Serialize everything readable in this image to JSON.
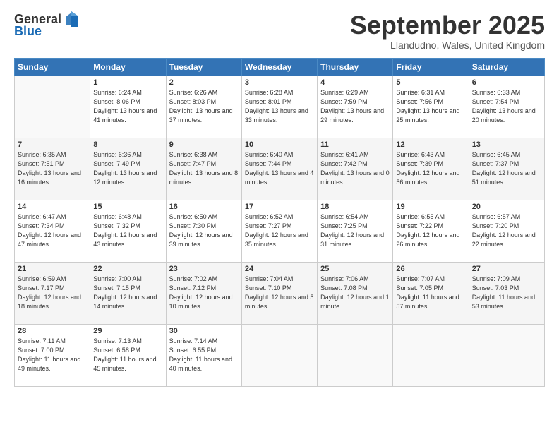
{
  "logo": {
    "general": "General",
    "blue": "Blue"
  },
  "header": {
    "month": "September 2025",
    "location": "Llandudno, Wales, United Kingdom"
  },
  "days_of_week": [
    "Sunday",
    "Monday",
    "Tuesday",
    "Wednesday",
    "Thursday",
    "Friday",
    "Saturday"
  ],
  "weeks": [
    [
      {
        "num": "",
        "sunrise": "",
        "sunset": "",
        "daylight": ""
      },
      {
        "num": "1",
        "sunrise": "Sunrise: 6:24 AM",
        "sunset": "Sunset: 8:06 PM",
        "daylight": "Daylight: 13 hours and 41 minutes."
      },
      {
        "num": "2",
        "sunrise": "Sunrise: 6:26 AM",
        "sunset": "Sunset: 8:03 PM",
        "daylight": "Daylight: 13 hours and 37 minutes."
      },
      {
        "num": "3",
        "sunrise": "Sunrise: 6:28 AM",
        "sunset": "Sunset: 8:01 PM",
        "daylight": "Daylight: 13 hours and 33 minutes."
      },
      {
        "num": "4",
        "sunrise": "Sunrise: 6:29 AM",
        "sunset": "Sunset: 7:59 PM",
        "daylight": "Daylight: 13 hours and 29 minutes."
      },
      {
        "num": "5",
        "sunrise": "Sunrise: 6:31 AM",
        "sunset": "Sunset: 7:56 PM",
        "daylight": "Daylight: 13 hours and 25 minutes."
      },
      {
        "num": "6",
        "sunrise": "Sunrise: 6:33 AM",
        "sunset": "Sunset: 7:54 PM",
        "daylight": "Daylight: 13 hours and 20 minutes."
      }
    ],
    [
      {
        "num": "7",
        "sunrise": "Sunrise: 6:35 AM",
        "sunset": "Sunset: 7:51 PM",
        "daylight": "Daylight: 13 hours and 16 minutes."
      },
      {
        "num": "8",
        "sunrise": "Sunrise: 6:36 AM",
        "sunset": "Sunset: 7:49 PM",
        "daylight": "Daylight: 13 hours and 12 minutes."
      },
      {
        "num": "9",
        "sunrise": "Sunrise: 6:38 AM",
        "sunset": "Sunset: 7:47 PM",
        "daylight": "Daylight: 13 hours and 8 minutes."
      },
      {
        "num": "10",
        "sunrise": "Sunrise: 6:40 AM",
        "sunset": "Sunset: 7:44 PM",
        "daylight": "Daylight: 13 hours and 4 minutes."
      },
      {
        "num": "11",
        "sunrise": "Sunrise: 6:41 AM",
        "sunset": "Sunset: 7:42 PM",
        "daylight": "Daylight: 13 hours and 0 minutes."
      },
      {
        "num": "12",
        "sunrise": "Sunrise: 6:43 AM",
        "sunset": "Sunset: 7:39 PM",
        "daylight": "Daylight: 12 hours and 56 minutes."
      },
      {
        "num": "13",
        "sunrise": "Sunrise: 6:45 AM",
        "sunset": "Sunset: 7:37 PM",
        "daylight": "Daylight: 12 hours and 51 minutes."
      }
    ],
    [
      {
        "num": "14",
        "sunrise": "Sunrise: 6:47 AM",
        "sunset": "Sunset: 7:34 PM",
        "daylight": "Daylight: 12 hours and 47 minutes."
      },
      {
        "num": "15",
        "sunrise": "Sunrise: 6:48 AM",
        "sunset": "Sunset: 7:32 PM",
        "daylight": "Daylight: 12 hours and 43 minutes."
      },
      {
        "num": "16",
        "sunrise": "Sunrise: 6:50 AM",
        "sunset": "Sunset: 7:30 PM",
        "daylight": "Daylight: 12 hours and 39 minutes."
      },
      {
        "num": "17",
        "sunrise": "Sunrise: 6:52 AM",
        "sunset": "Sunset: 7:27 PM",
        "daylight": "Daylight: 12 hours and 35 minutes."
      },
      {
        "num": "18",
        "sunrise": "Sunrise: 6:54 AM",
        "sunset": "Sunset: 7:25 PM",
        "daylight": "Daylight: 12 hours and 31 minutes."
      },
      {
        "num": "19",
        "sunrise": "Sunrise: 6:55 AM",
        "sunset": "Sunset: 7:22 PM",
        "daylight": "Daylight: 12 hours and 26 minutes."
      },
      {
        "num": "20",
        "sunrise": "Sunrise: 6:57 AM",
        "sunset": "Sunset: 7:20 PM",
        "daylight": "Daylight: 12 hours and 22 minutes."
      }
    ],
    [
      {
        "num": "21",
        "sunrise": "Sunrise: 6:59 AM",
        "sunset": "Sunset: 7:17 PM",
        "daylight": "Daylight: 12 hours and 18 minutes."
      },
      {
        "num": "22",
        "sunrise": "Sunrise: 7:00 AM",
        "sunset": "Sunset: 7:15 PM",
        "daylight": "Daylight: 12 hours and 14 minutes."
      },
      {
        "num": "23",
        "sunrise": "Sunrise: 7:02 AM",
        "sunset": "Sunset: 7:12 PM",
        "daylight": "Daylight: 12 hours and 10 minutes."
      },
      {
        "num": "24",
        "sunrise": "Sunrise: 7:04 AM",
        "sunset": "Sunset: 7:10 PM",
        "daylight": "Daylight: 12 hours and 5 minutes."
      },
      {
        "num": "25",
        "sunrise": "Sunrise: 7:06 AM",
        "sunset": "Sunset: 7:08 PM",
        "daylight": "Daylight: 12 hours and 1 minute."
      },
      {
        "num": "26",
        "sunrise": "Sunrise: 7:07 AM",
        "sunset": "Sunset: 7:05 PM",
        "daylight": "Daylight: 11 hours and 57 minutes."
      },
      {
        "num": "27",
        "sunrise": "Sunrise: 7:09 AM",
        "sunset": "Sunset: 7:03 PM",
        "daylight": "Daylight: 11 hours and 53 minutes."
      }
    ],
    [
      {
        "num": "28",
        "sunrise": "Sunrise: 7:11 AM",
        "sunset": "Sunset: 7:00 PM",
        "daylight": "Daylight: 11 hours and 49 minutes."
      },
      {
        "num": "29",
        "sunrise": "Sunrise: 7:13 AM",
        "sunset": "Sunset: 6:58 PM",
        "daylight": "Daylight: 11 hours and 45 minutes."
      },
      {
        "num": "30",
        "sunrise": "Sunrise: 7:14 AM",
        "sunset": "Sunset: 6:55 PM",
        "daylight": "Daylight: 11 hours and 40 minutes."
      },
      {
        "num": "",
        "sunrise": "",
        "sunset": "",
        "daylight": ""
      },
      {
        "num": "",
        "sunrise": "",
        "sunset": "",
        "daylight": ""
      },
      {
        "num": "",
        "sunrise": "",
        "sunset": "",
        "daylight": ""
      },
      {
        "num": "",
        "sunrise": "",
        "sunset": "",
        "daylight": ""
      }
    ]
  ]
}
